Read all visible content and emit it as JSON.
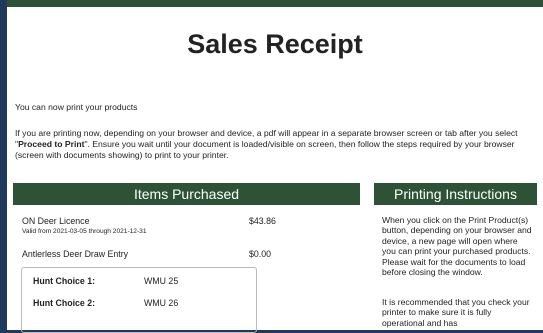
{
  "page": {
    "title": "Sales Receipt",
    "intro": "You can now print your products",
    "instructions_before": "If you are printing now, depending on your browser and device, a pdf will appear in a separate browser screen or tab after you select \"",
    "instructions_bold": "Proceed to Print",
    "instructions_after": "\".  Ensure you wait until your document is loaded/visible on screen, then follow the steps required by your browser (screen with documents showing) to print to your printer."
  },
  "items_section": {
    "header": "Items Purchased",
    "items": [
      {
        "name": "ON Deer Licence",
        "sub": "Valid from 2021-03-05 through 2021-12-31",
        "price": "$43.86"
      },
      {
        "name": "Antlerless Deer Draw Entry",
        "sub": "",
        "price": "$0.00"
      }
    ],
    "hunt_choices": [
      {
        "label": "Hunt Choice 1:",
        "value": "WMU  25"
      },
      {
        "label": "Hunt Choice 2:",
        "value": "WMU  26"
      }
    ]
  },
  "printing_section": {
    "header": "Printing Instructions",
    "paragraph1": "When you click on the Print Product(s) button, depending on your browser and device, a new page will open where you can print your purchased products. Please wait for the documents to load before closing the window.",
    "paragraph2": "It is recommended that you check your printer to make sure it is fully operational and has"
  },
  "colors": {
    "header_green": "#2e5236",
    "page_background": "#1d3a5c"
  }
}
